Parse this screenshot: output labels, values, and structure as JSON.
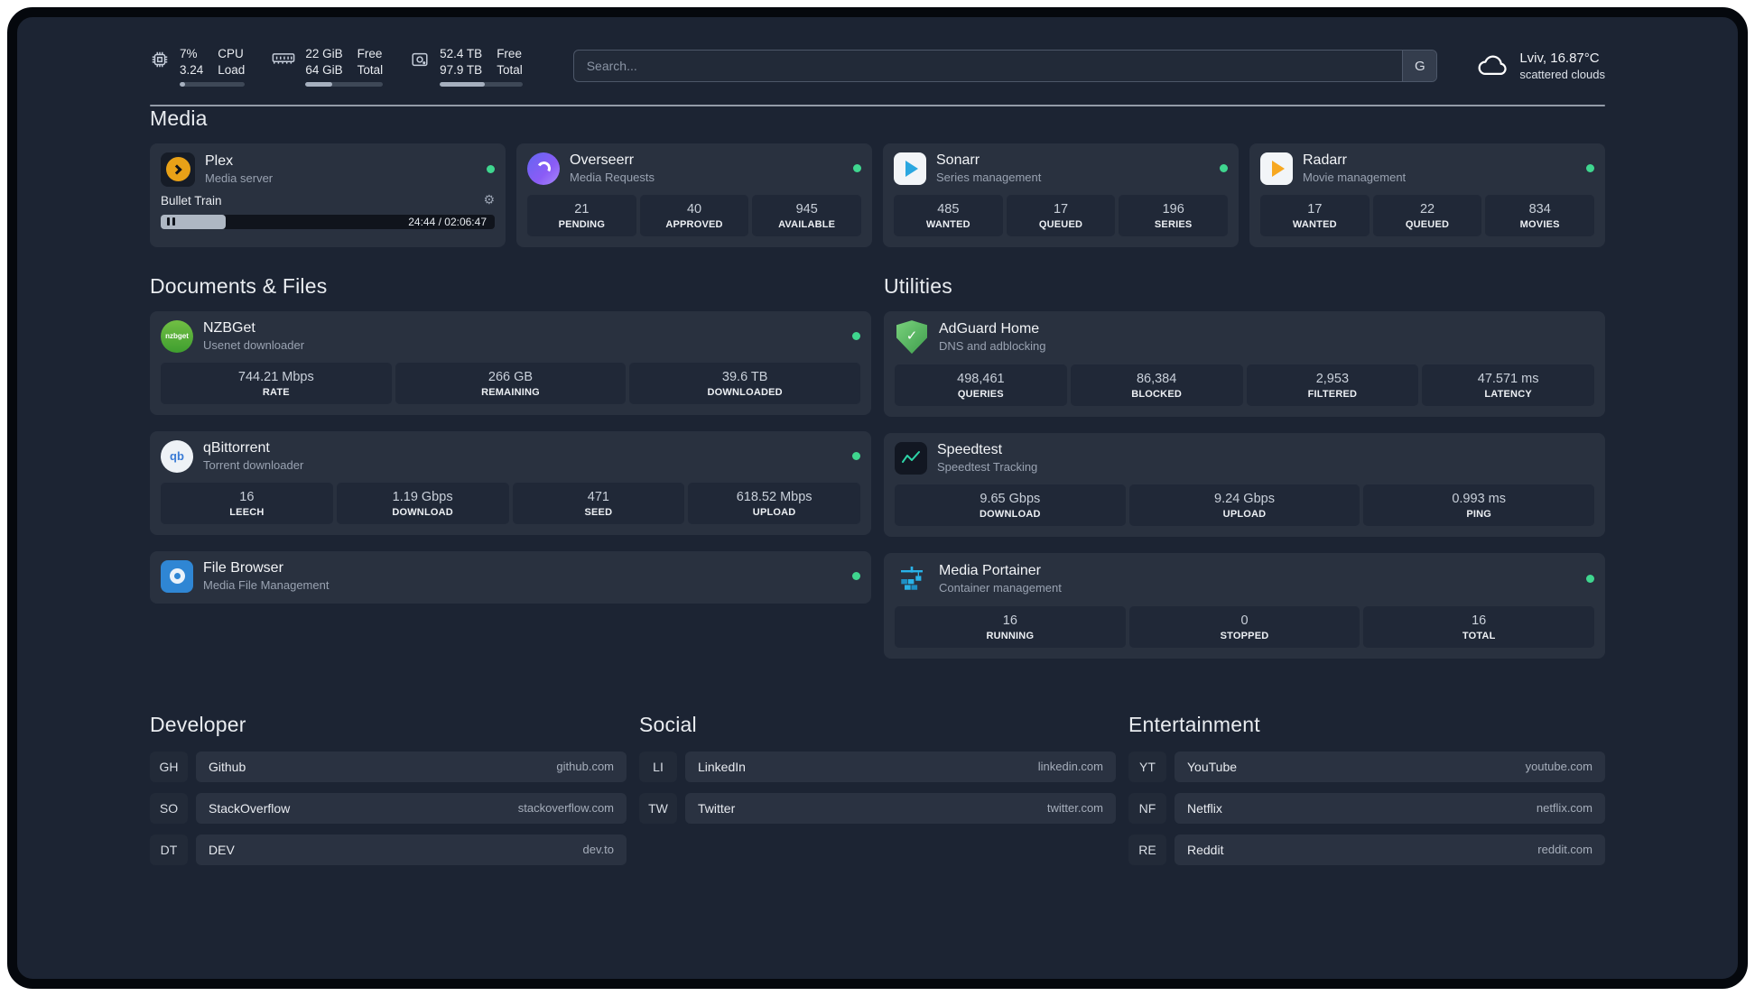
{
  "colors": {
    "background": "#1c2433",
    "card": "#29313f",
    "stat_tile": "#202837",
    "status_online_green": "#3fd68f",
    "text_primary": "#f2f4f7",
    "text_secondary": "#99a2b1"
  },
  "topbar": {
    "cpu": {
      "value_top": "7%",
      "value_bottom": "3.24",
      "label_top": "CPU",
      "label_bottom": "Load",
      "bar": "8%"
    },
    "ram": {
      "value_top": "22 GiB",
      "value_bottom": "64 GiB",
      "label_top": "Free",
      "label_bottom": "Total",
      "bar": "34%"
    },
    "disk": {
      "value_top": "52.4 TB",
      "value_bottom": "97.9 TB",
      "label_top": "Free",
      "label_bottom": "Total",
      "bar": "54%"
    },
    "search": {
      "placeholder": "Search...",
      "provider": "G"
    },
    "weather": {
      "location": "Lviv, 16.87°C",
      "condition": "scattered clouds"
    }
  },
  "sections": {
    "media": {
      "title": "Media"
    },
    "documents": {
      "title": "Documents & Files"
    },
    "utilities": {
      "title": "Utilities"
    },
    "developer": {
      "title": "Developer"
    },
    "social": {
      "title": "Social"
    },
    "entertainment": {
      "title": "Entertainment"
    }
  },
  "media": {
    "plex": {
      "name": "Plex",
      "subtitle": "Media server",
      "now_playing": {
        "title": "Bullet Train",
        "time": "24:44 / 02:06:47",
        "progress": "19.5%"
      }
    },
    "overseerr": {
      "name": "Overseerr",
      "subtitle": "Media Requests",
      "stats": [
        {
          "value": "21",
          "label": "PENDING"
        },
        {
          "value": "40",
          "label": "APPROVED"
        },
        {
          "value": "945",
          "label": "AVAILABLE"
        }
      ]
    },
    "sonarr": {
      "name": "Sonarr",
      "subtitle": "Series management",
      "stats": [
        {
          "value": "485",
          "label": "WANTED"
        },
        {
          "value": "17",
          "label": "QUEUED"
        },
        {
          "value": "196",
          "label": "SERIES"
        }
      ]
    },
    "radarr": {
      "name": "Radarr",
      "subtitle": "Movie management",
      "stats": [
        {
          "value": "17",
          "label": "WANTED"
        },
        {
          "value": "22",
          "label": "QUEUED"
        },
        {
          "value": "834",
          "label": "MOVIES"
        }
      ]
    }
  },
  "documents": {
    "nzbget": {
      "name": "NZBGet",
      "subtitle": "Usenet downloader",
      "icon_text": "nzbget",
      "stats": [
        {
          "value": "744.21 Mbps",
          "label": "RATE"
        },
        {
          "value": "266 GB",
          "label": "REMAINING"
        },
        {
          "value": "39.6 TB",
          "label": "DOWNLOADED"
        }
      ]
    },
    "qbittorrent": {
      "name": "qBittorrent",
      "subtitle": "Torrent downloader",
      "icon_text": "qb",
      "stats": [
        {
          "value": "16",
          "label": "LEECH"
        },
        {
          "value": "1.19 Gbps",
          "label": "DOWNLOAD"
        },
        {
          "value": "471",
          "label": "SEED"
        },
        {
          "value": "618.52 Mbps",
          "label": "UPLOAD"
        }
      ]
    },
    "filebrowser": {
      "name": "File Browser",
      "subtitle": "Media File Management"
    }
  },
  "utilities": {
    "adguard": {
      "name": "AdGuard Home",
      "subtitle": "DNS and adblocking",
      "stats": [
        {
          "value": "498,461",
          "label": "QUERIES"
        },
        {
          "value": "86,384",
          "label": "BLOCKED"
        },
        {
          "value": "2,953",
          "label": "FILTERED"
        },
        {
          "value": "47.571 ms",
          "label": "LATENCY"
        }
      ]
    },
    "speedtest": {
      "name": "Speedtest",
      "subtitle": "Speedtest Tracking",
      "stats": [
        {
          "value": "9.65 Gbps",
          "label": "DOWNLOAD"
        },
        {
          "value": "9.24 Gbps",
          "label": "UPLOAD"
        },
        {
          "value": "0.993 ms",
          "label": "PING"
        }
      ]
    },
    "portainer": {
      "name": "Media Portainer",
      "subtitle": "Container management",
      "stats": [
        {
          "value": "16",
          "label": "RUNNING"
        },
        {
          "value": "0",
          "label": "STOPPED"
        },
        {
          "value": "16",
          "label": "TOTAL"
        }
      ]
    }
  },
  "bookmarks": {
    "developer": [
      {
        "abbr": "GH",
        "name": "Github",
        "url": "github.com"
      },
      {
        "abbr": "SO",
        "name": "StackOverflow",
        "url": "stackoverflow.com"
      },
      {
        "abbr": "DT",
        "name": "DEV",
        "url": "dev.to"
      }
    ],
    "social": [
      {
        "abbr": "LI",
        "name": "LinkedIn",
        "url": "linkedin.com"
      },
      {
        "abbr": "TW",
        "name": "Twitter",
        "url": "twitter.com"
      }
    ],
    "entertainment": [
      {
        "abbr": "YT",
        "name": "YouTube",
        "url": "youtube.com"
      },
      {
        "abbr": "NF",
        "name": "Netflix",
        "url": "netflix.com"
      },
      {
        "abbr": "RE",
        "name": "Reddit",
        "url": "reddit.com"
      }
    ]
  }
}
